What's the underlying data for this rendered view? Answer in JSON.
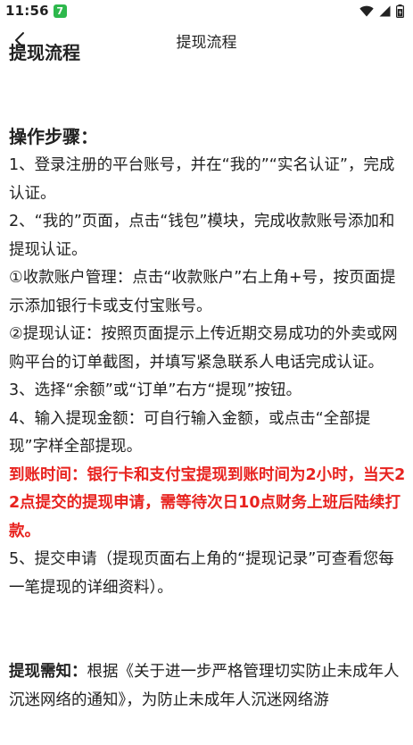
{
  "status_bar": {
    "time": "11:56",
    "app_badge": "7"
  },
  "nav": {
    "title": "提现流程"
  },
  "content": {
    "cut_heading": "提现流程",
    "steps_heading": "操作步骤：",
    "steps": [
      "1、登录注册的平台账号，并在“我的”“实名认证”，完成认证。",
      "2、“我的”页面，点击“钱包”模块，完成收款账号添加和提现认证。",
      "①收款账户管理：点击“收款账户”右上角+号，按页面提示添加银行卡或支付宝账号。",
      "②提现认证：按照页面提示上传近期交易成功的外卖或网购平台的订单截图，并填写紧急联系人电话完成认证。",
      "3、选择“余额”或“订单”右方“提现”按钮。",
      "4、输入提现金额：可自行输入金额，或点击“全部提现”字样全部提现。"
    ],
    "arrival_notice": "到账时间：银行卡和支付宝提现到账时间为2小时，当天22点提交的提现申请，需等待次日10点财务上班后陆续打款。",
    "step5": "5、提交申请（提现页面右上角的“提现记录”可查看您每一笔提现的详细资料）。",
    "notice_label": "提现需知：",
    "notice_text": "根据《关于进一步严格管理切实防止未成年人沉迷网络的通知》，为防止未成年人沉迷网络游"
  },
  "colors": {
    "highlight_red": "#e8231f",
    "app_badge_green": "#2db84c"
  }
}
